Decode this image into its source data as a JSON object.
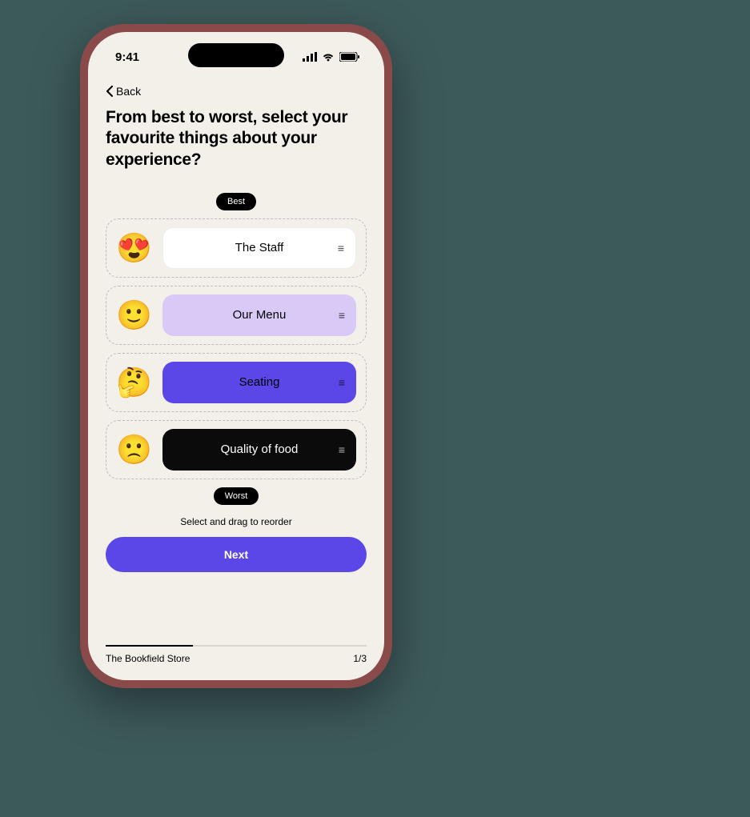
{
  "status": {
    "time": "9:41"
  },
  "nav": {
    "back_label": "Back"
  },
  "question": "From best to worst, select your favourite things about your experience?",
  "labels": {
    "best": "Best",
    "worst": "Worst"
  },
  "items": [
    {
      "emoji": "😍",
      "label": "The Staff",
      "chip": "white"
    },
    {
      "emoji": "🙂",
      "label": "Our Menu",
      "chip": "lilac"
    },
    {
      "emoji": "🤔",
      "label": "Seating",
      "chip": "purple"
    },
    {
      "emoji": "🙁",
      "label": "Quality of food",
      "chip": "black"
    }
  ],
  "hint": "Select and drag to reorder",
  "actions": {
    "next_label": "Next"
  },
  "footer": {
    "store": "The Bookfield Store",
    "page": "1/3"
  },
  "colors": {
    "accent": "#5b46e8",
    "lilac": "#d9c9f7",
    "screen_bg": "#f3f0ea"
  }
}
